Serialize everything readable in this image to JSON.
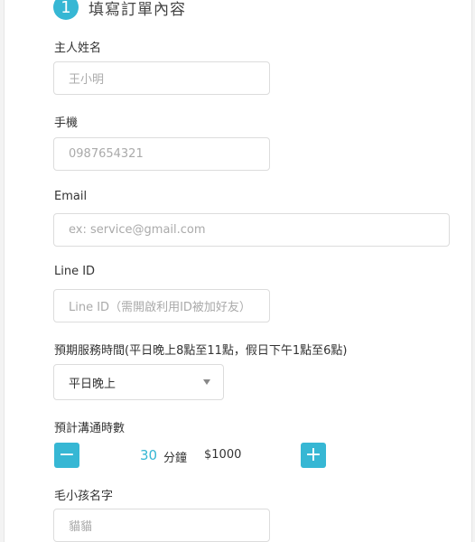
{
  "step": {
    "number": "1",
    "title": "填寫訂單內容"
  },
  "fields": {
    "owner_name": {
      "label": "主人姓名",
      "placeholder": "王小明"
    },
    "phone": {
      "label": "手機",
      "placeholder": "0987654321"
    },
    "email": {
      "label": "Email",
      "placeholder": "ex: service@gmail.com"
    },
    "line_id": {
      "label": "Line ID",
      "placeholder": "Line ID（需開啟利用ID被加好友）"
    },
    "service_time": {
      "label": "預期服務時間(平日晚上8點至11點，假日下午1點至6點)",
      "selected": "平日晚上"
    },
    "duration": {
      "label": "預計溝通時數",
      "minus": "−",
      "plus": "+",
      "value": "30",
      "unit": "分鐘",
      "price": "$1000"
    },
    "pet_name": {
      "label": "毛小孩名字",
      "placeholder": "貓貓"
    }
  },
  "colors": {
    "accent": "#36b7d4",
    "border": "#dcdcdc",
    "placeholder": "#aaaaaa"
  }
}
